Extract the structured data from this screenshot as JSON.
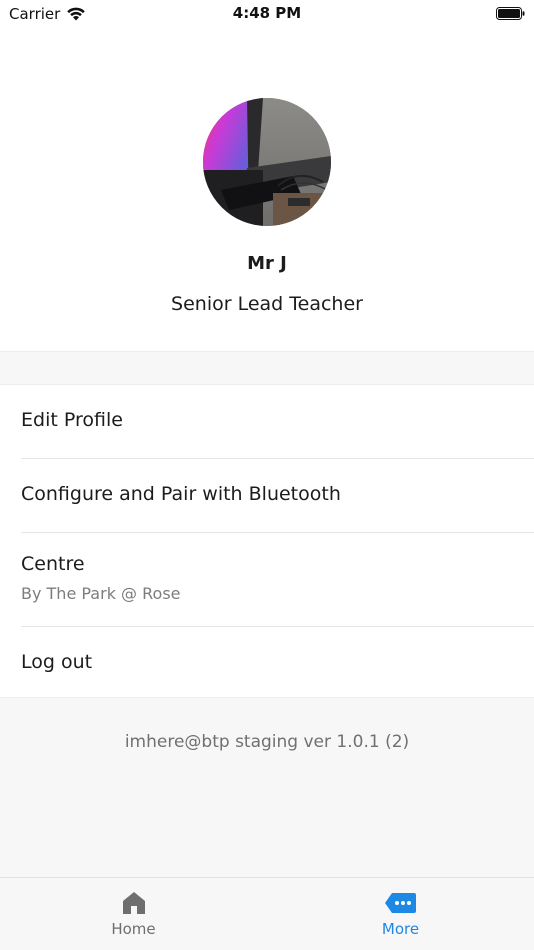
{
  "status_bar": {
    "carrier": "Carrier",
    "time": "4:48 PM"
  },
  "profile": {
    "name": "Mr J",
    "role": "Senior Lead Teacher"
  },
  "menu": {
    "edit_profile": "Edit Profile",
    "bluetooth": "Configure and Pair with Bluetooth",
    "centre_label": "Centre",
    "centre_value": "By The Park @ Rose",
    "logout": "Log out"
  },
  "version": "imhere@btp staging ver 1.0.1 (2)",
  "tabbar": {
    "home": "Home",
    "more": "More"
  },
  "colors": {
    "accent": "#1e88e5",
    "inactive": "#6e6e6e"
  },
  "icons": {
    "home": "home-icon",
    "more": "more-icon",
    "wifi": "wifi-icon",
    "battery": "battery-icon"
  }
}
